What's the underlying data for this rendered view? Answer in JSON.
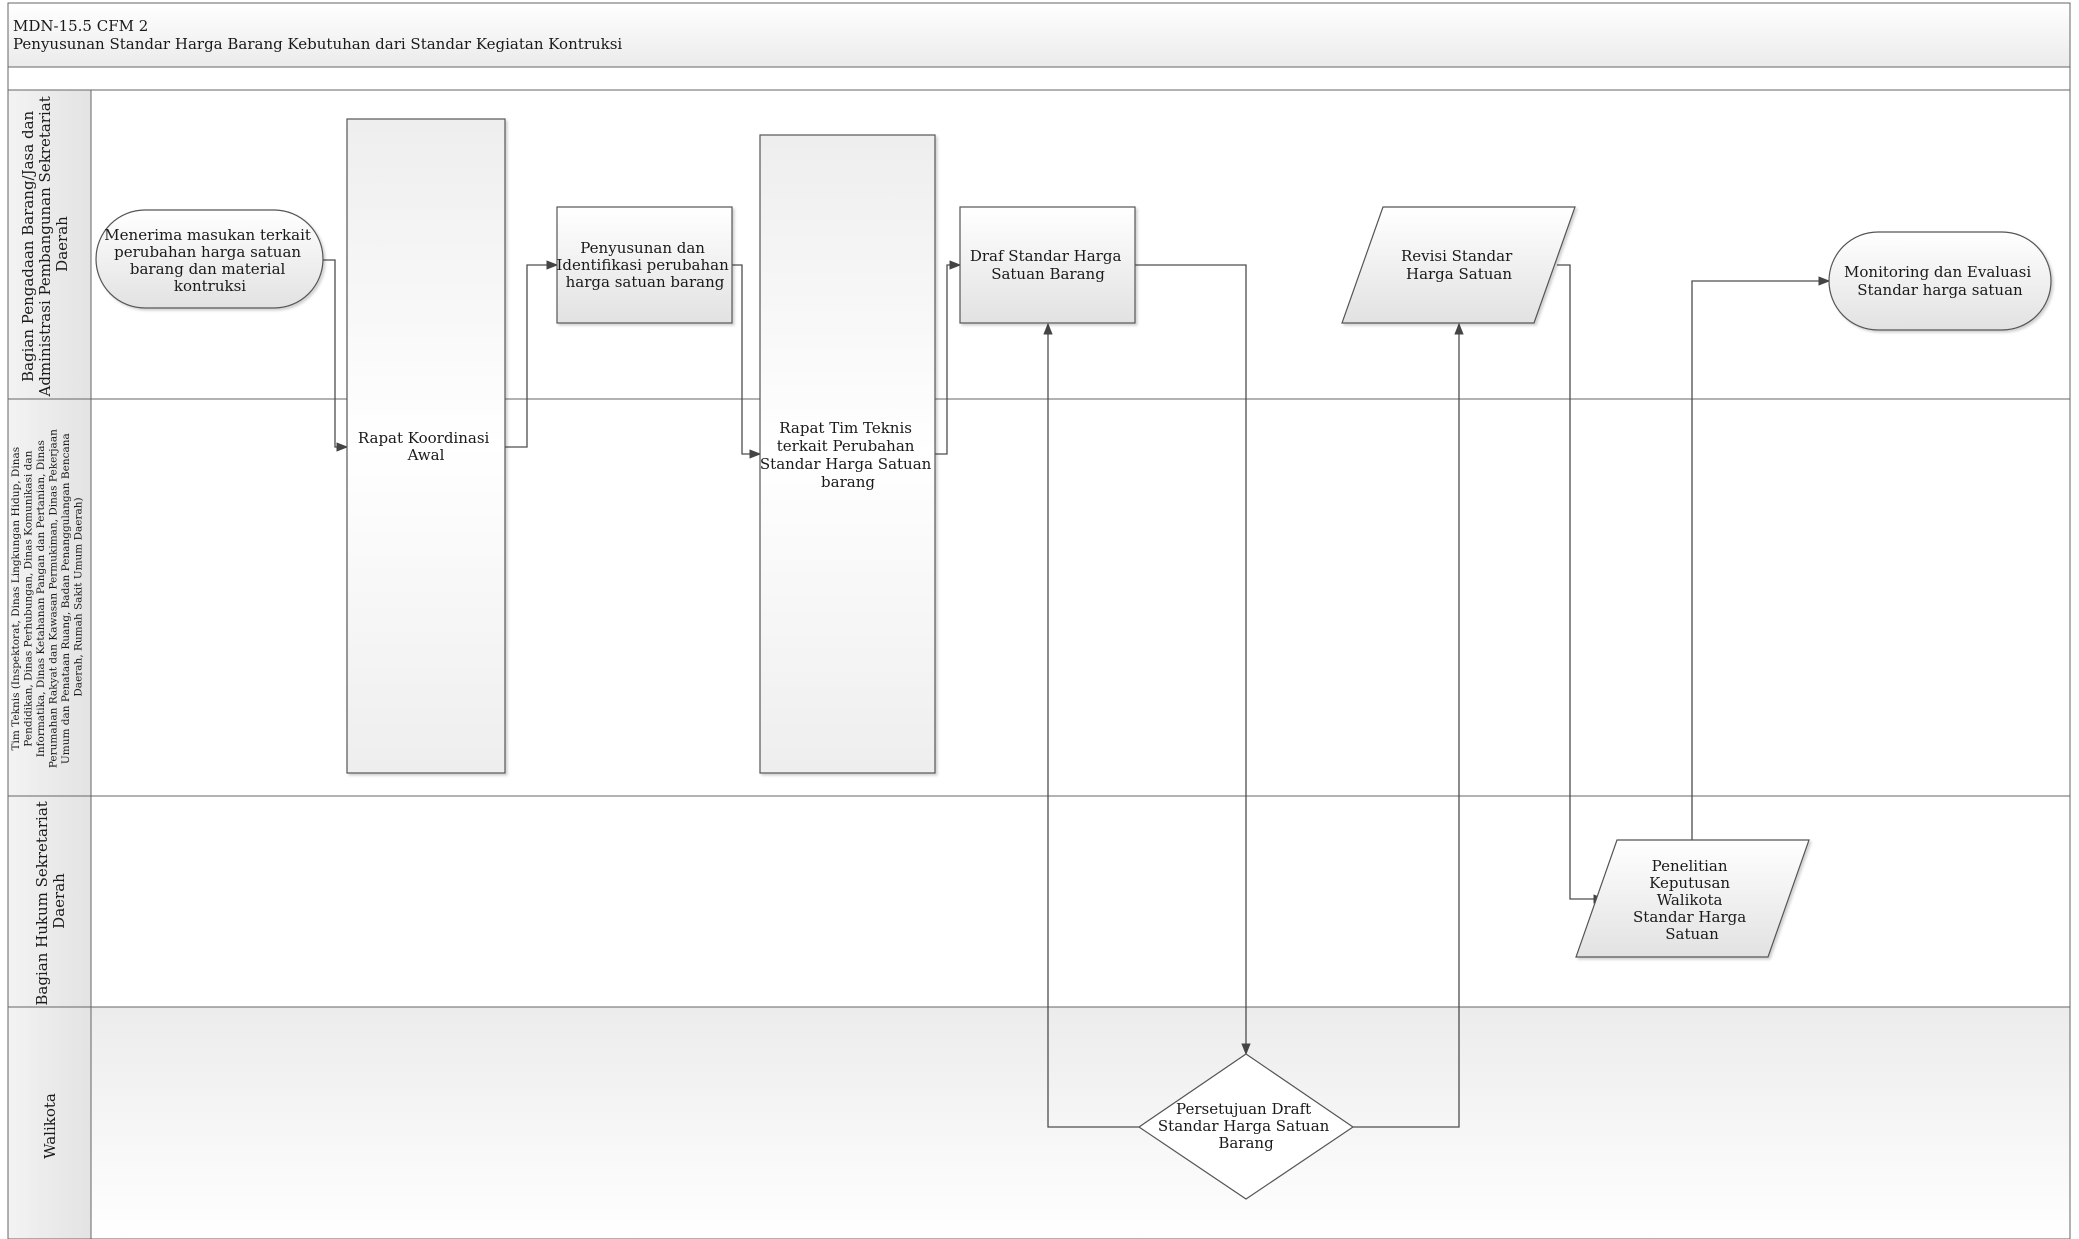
{
  "header": {
    "code": "MDN-15.5 CFM 2",
    "title": "Penyusunan Standar Harga Barang Kebutuhan dari Standar Kegiatan Kontruksi"
  },
  "lanes": [
    {
      "id": "lane-bagian-pengadaan",
      "label_lines": [
        "Bagian Pengadaan Barang/Jasa dan",
        "Administrasi Pembangunan Sekretariat",
        "Daerah"
      ]
    },
    {
      "id": "lane-tim-teknis",
      "label_lines": [
        "Tim Teknis (Inspektorat, Dinas Lingkungan Hidup, Dinas",
        "Pendidikan, Dinas Perhubungan, Dinas Komunikasi dan",
        "Informatika, Dinas Ketahanan Pangan dan Pertanian, Dinas",
        "Perumahan Rakyat dan Kawasan Permukiman, Dinas Pekerjaan",
        "Umum dan Penataan Ruang, Badan Penanggulangan Bencana",
        "Daerah, Rumah Sakit Umum Daerah)"
      ]
    },
    {
      "id": "lane-bagian-hukum",
      "label_lines": [
        "Bagian Hukum Sekretariat",
        "Daerah"
      ]
    },
    {
      "id": "lane-walikota",
      "label_lines": [
        "Walikota"
      ]
    }
  ],
  "nodes": [
    {
      "id": "menerima-masukan",
      "shape": "terminator",
      "lines": [
        "Menerima masukan terkait",
        "perubahan harga satuan",
        "barang dan material",
        "kontruksi"
      ]
    },
    {
      "id": "rapat-koordinasi-awal",
      "shape": "process-tall",
      "lines": [
        "Rapat Koordinasi",
        "Awal"
      ]
    },
    {
      "id": "penyusunan-identifikasi",
      "shape": "process",
      "lines": [
        "Penyusunan dan",
        "Identifikasi perubahan",
        "harga satuan barang"
      ]
    },
    {
      "id": "rapat-tim-teknis",
      "shape": "process-tall",
      "lines": [
        "Rapat Tim Teknis",
        "terkait Perubahan",
        "Standar Harga Satuan",
        "barang"
      ]
    },
    {
      "id": "draf-standar-harga",
      "shape": "process",
      "lines": [
        "Draf Standar Harga",
        "Satuan Barang"
      ]
    },
    {
      "id": "revisi-standar-harga",
      "shape": "data",
      "lines": [
        "Revisi Standar",
        "Harga Satuan"
      ]
    },
    {
      "id": "monitoring-evaluasi",
      "shape": "terminator",
      "lines": [
        "Monitoring dan Evaluasi",
        "Standar harga satuan"
      ]
    },
    {
      "id": "penelitian-keputusan",
      "shape": "data",
      "lines": [
        "Penelitian",
        "Keputusan",
        "Walikota",
        "Standar Harga",
        "Satuan"
      ]
    },
    {
      "id": "persetujuan-draft",
      "shape": "decision",
      "lines": [
        "Persetujuan Draft",
        "Standar Harga Satuan",
        "Barang"
      ]
    }
  ],
  "connectors": [
    {
      "from": "menerima-masukan",
      "to": "rapat-koordinasi-awal"
    },
    {
      "from": "rapat-koordinasi-awal",
      "to": "penyusunan-identifikasi"
    },
    {
      "from": "penyusunan-identifikasi",
      "to": "rapat-tim-teknis"
    },
    {
      "from": "rapat-tim-teknis",
      "to": "draf-standar-harga"
    },
    {
      "from": "draf-standar-harga",
      "to": "persetujuan-draft"
    },
    {
      "from": "persetujuan-draft",
      "to": "draf-standar-harga"
    },
    {
      "from": "persetujuan-draft",
      "to": "revisi-standar-harga"
    },
    {
      "from": "revisi-standar-harga",
      "to": "penelitian-keputusan"
    },
    {
      "from": "penelitian-keputusan",
      "to": "monitoring-evaluasi"
    }
  ],
  "colors": {
    "line": "#555555",
    "shape_fill_top": "#ffffff",
    "shape_fill_bottom": "#e4e4e4",
    "lane_header": "#ececec"
  }
}
